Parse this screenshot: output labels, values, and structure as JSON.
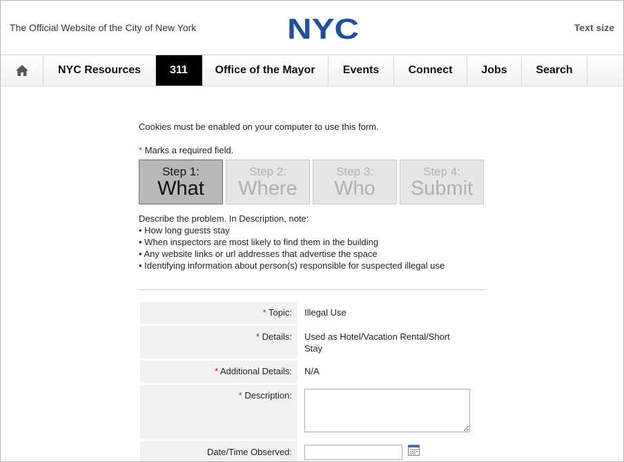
{
  "header": {
    "tagline": "The Official Website of the City of New York",
    "logo_text": "NYC",
    "text_size": "Text size"
  },
  "nav": {
    "items": [
      {
        "label": "NYC Resources"
      },
      {
        "label": "311",
        "active": true
      },
      {
        "label": "Office of the Mayor"
      },
      {
        "label": "Events"
      },
      {
        "label": "Connect"
      },
      {
        "label": "Jobs"
      },
      {
        "label": "Search"
      }
    ]
  },
  "form": {
    "cookie_note": "Cookies must be enabled on your computer to use this form.",
    "required_marker": "*",
    "required_note": "Marks a required field.",
    "steps": [
      {
        "num": "Step 1:",
        "name": "What",
        "active": true
      },
      {
        "num": "Step 2:",
        "name": "Where"
      },
      {
        "num": "Step 3:",
        "name": "Who"
      },
      {
        "num": "Step 4:",
        "name": "Submit"
      }
    ],
    "description_intro": "Describe the problem. In Description, note:",
    "description_bullets": [
      "How long guests stay",
      "When inspectors are most likely to find them in the building",
      "Any website links or url addresses that advertise the space",
      "Identifying information about person(s) responsible for suspected illegal use"
    ],
    "fields": {
      "topic": {
        "label": "Topic:",
        "value": "Illegal Use"
      },
      "details": {
        "label": "Details:",
        "value": "Used as Hotel/Vacation Rental/Short Stay"
      },
      "additional_details": {
        "label": "Additional Details:",
        "value": "N/A"
      },
      "description": {
        "label": "Description:",
        "value": ""
      },
      "date_time": {
        "label": "Date/Time Observed:",
        "value": ""
      }
    }
  },
  "colors": {
    "required": "#c8102e",
    "logo_blue": "#1f4fa0",
    "nav_active_bg": "#000000"
  }
}
